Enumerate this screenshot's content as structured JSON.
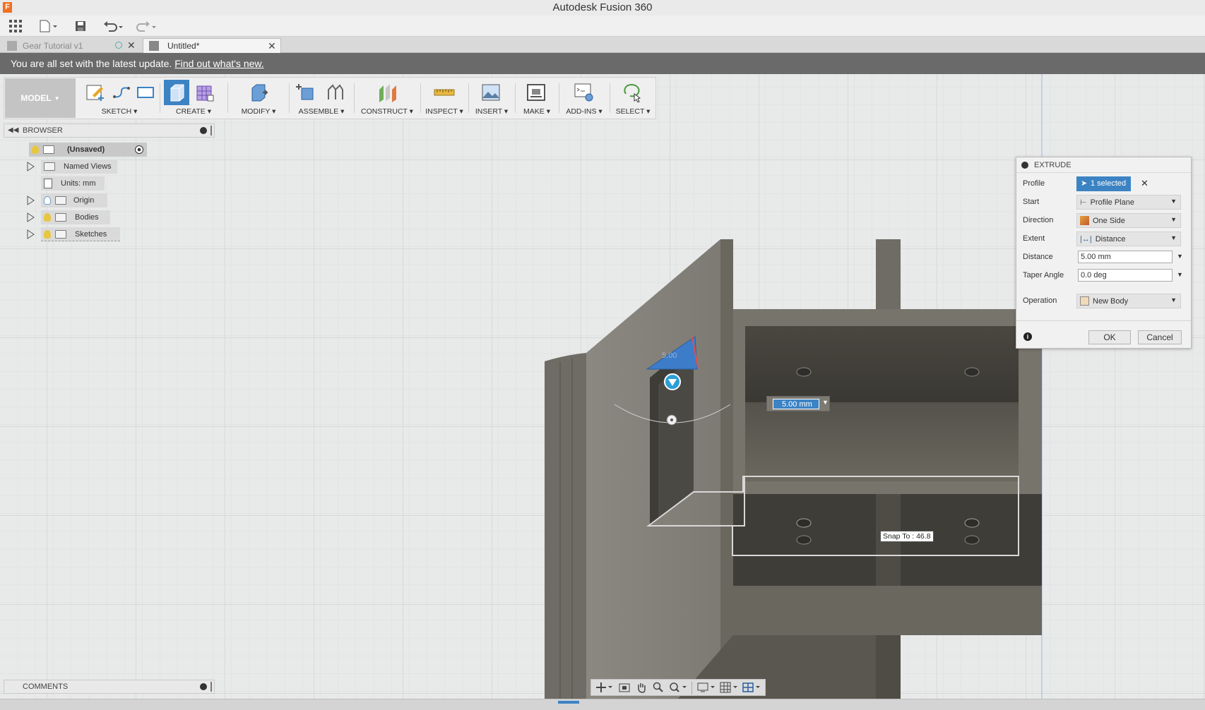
{
  "app": {
    "title": "Autodesk Fusion 360",
    "logo_letter": "F"
  },
  "tabs": [
    {
      "label": "Gear Tutorial v1",
      "active": false
    },
    {
      "label": "Untitled*",
      "active": true
    }
  ],
  "notification": {
    "text": "You are all set with the latest update.",
    "link": "Find out what's new."
  },
  "toolbar": {
    "workspace": "MODEL",
    "groups": [
      "SKETCH",
      "CREATE",
      "MODIFY",
      "ASSEMBLE",
      "CONSTRUCT",
      "INSPECT",
      "INSERT",
      "MAKE",
      "ADD-INS",
      "SELECT"
    ]
  },
  "browser": {
    "title": "BROWSER",
    "items": [
      {
        "label": "(Unsaved)"
      },
      {
        "label": "Named Views"
      },
      {
        "label": "Units: mm"
      },
      {
        "label": "Origin"
      },
      {
        "label": "Bodies"
      },
      {
        "label": "Sketches"
      }
    ]
  },
  "comments": {
    "title": "COMMENTS"
  },
  "extrude": {
    "title": "EXTRUDE",
    "rows": [
      {
        "label": "Profile",
        "value": "1 selected"
      },
      {
        "label": "Start",
        "value": "Profile Plane"
      },
      {
        "label": "Direction",
        "value": "One Side"
      },
      {
        "label": "Extent",
        "value": "Distance"
      },
      {
        "label": "Distance",
        "value": "5.00 mm"
      },
      {
        "label": "Taper Angle",
        "value": "0.0 deg"
      },
      {
        "label": "Operation",
        "value": "New Body"
      }
    ],
    "ok": "OK",
    "cancel": "Cancel"
  },
  "canvas": {
    "distance_input": "5.00 mm",
    "snap_tooltip": "Snap To : 46.8",
    "manip_value": "5.00"
  },
  "colors": {
    "accent": "#3c83c4",
    "notification_bg": "#6a6a6a",
    "body_gray": "#77746c"
  }
}
